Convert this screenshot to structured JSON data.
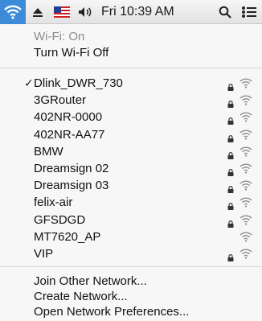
{
  "menubar": {
    "clock": "Fri 10:39 AM",
    "icons": [
      "wifi-icon",
      "eject-icon",
      "flag-icon",
      "volume-icon",
      "search-icon",
      "list-icon"
    ]
  },
  "wifi_status": "Wi-Fi: On",
  "toggle_label": "Turn Wi-Fi Off",
  "connected_mark": "✓",
  "networks": [
    {
      "name": "Dlink_DWR_730",
      "locked": true,
      "connected": true
    },
    {
      "name": "3GRouter",
      "locked": true
    },
    {
      "name": "402NR-0000",
      "locked": true
    },
    {
      "name": "402NR-AA77",
      "locked": true
    },
    {
      "name": "BMW",
      "locked": true
    },
    {
      "name": "Dreamsign 02",
      "locked": true
    },
    {
      "name": "Dreamsign 03",
      "locked": true
    },
    {
      "name": "felix-air",
      "locked": true
    },
    {
      "name": "GFSDGD",
      "locked": true
    },
    {
      "name": "MT7620_AP",
      "locked": false
    },
    {
      "name": "VIP",
      "locked": true
    }
  ],
  "footer": {
    "join": "Join Other Network...",
    "create": "Create Network...",
    "prefs": "Open Network Preferences..."
  },
  "colors": {
    "menubar_highlight": "#3b8bd9",
    "menu_bg": "#f7f7f7",
    "separator": "#d6d6d6"
  }
}
